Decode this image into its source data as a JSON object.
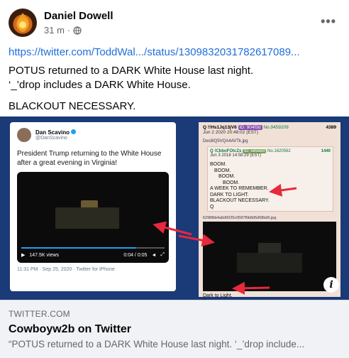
{
  "post": {
    "author": "Daniel Dowell",
    "time": "31 m",
    "more_icon": "more-horizontal-icon",
    "privacy_icon": "globe-icon",
    "link": "https://twitter.com/ToddWal.../status/1309832031782617089...",
    "lines": [
      "POTUS returned to a DARK White House last night.",
      "‘_’drop includes a DARK White House.",
      "BLACKOUT NECESSARY."
    ]
  },
  "image": {
    "tweet": {
      "name": "Dan Scavino",
      "handle": "@DanScavino",
      "text": "President Trump returning to the White House after a great evening in Virginia!",
      "views": "147.5K views",
      "duration": "0:04 / 0:05",
      "progress": 0.8,
      "footer": "11:31 PM · Sep 25, 2020 · Twitter for iPhone"
    },
    "qpost": {
      "header": "Q !!Hs1Jq13jV6",
      "id": "ID: 904f3d",
      "number": "No.9459209",
      "count": "4389",
      "date": "Jun 2 2020 20:48:02 (EST)",
      "link": "Dec8IQ5VQA4AVTk.jpg",
      "inner_header": "Q !CbboFOtcZs",
      "inner_id": "ID: 5e5ee3",
      "inner_number": "No.1620562",
      "inner_date": "Jun 3 2018 14:58:29 (EST)",
      "inner_count": "1440",
      "inner_lines": [
        "BOOM.",
        "BOOM.",
        "BOOM.",
        "BOOM.",
        "A WEEK TO REMEMBER.",
        "DARK TO LIGHT.",
        "BLACKOUT NECESSARY.",
        "Q"
      ],
      "file": "6298fbb4a6d0025c0587f6b8d5d58bd5.jpg",
      "caption": [
        "Dark to Light.",
        "Q"
      ]
    },
    "info_icon": "info-icon"
  },
  "preview": {
    "domain": "TWITTER.COM",
    "title": "Cowboyw2b on Twitter",
    "description": "“POTUS returned to a DARK White House last night. ‘_’drop include..."
  },
  "colors": {
    "link": "#216fdb",
    "image_bg": "#1a3a78",
    "arrow": "#e8283c"
  }
}
